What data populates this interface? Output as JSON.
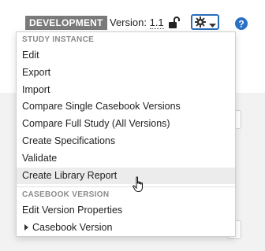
{
  "header": {
    "environment_badge": "DEVELOPMENT",
    "version_label": "Version: ",
    "version_number": "1.1",
    "lock_icon": "unlocked-padlock-icon",
    "settings_icon": "gear-icon",
    "caret_icon": "caret-down-icon",
    "help_icon": "question-circle-icon"
  },
  "menu": {
    "sections": [
      {
        "header": "STUDY INSTANCE",
        "items": [
          {
            "label": "Edit"
          },
          {
            "label": "Export"
          },
          {
            "label": "Import"
          },
          {
            "label": "Compare Single Casebook Versions"
          },
          {
            "label": "Compare Full Study (All Versions)"
          },
          {
            "label": "Create Specifications"
          },
          {
            "label": "Validate"
          },
          {
            "label": "Create Library Report",
            "hovered": true
          }
        ]
      },
      {
        "header": "CASEBOOK VERSION",
        "items": [
          {
            "label": "Edit Version Properties"
          },
          {
            "label": "Casebook Version",
            "expandable": true
          }
        ]
      }
    ]
  },
  "colors": {
    "badge_bg": "#7a7a7a",
    "accent_border": "#2a6ebb",
    "help_icon": "#2a72c6",
    "section_header": "#8a8a8a",
    "hover_bg": "#ececec"
  },
  "cursor": "hand-pointer-icon"
}
